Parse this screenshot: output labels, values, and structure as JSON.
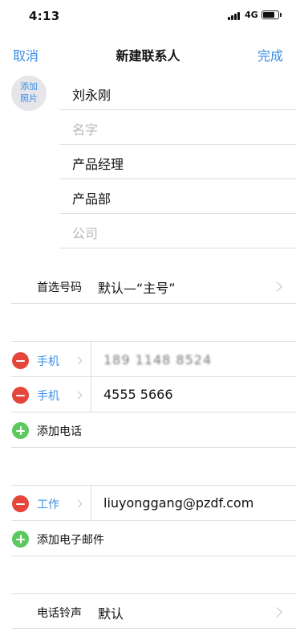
{
  "status_bar": {
    "time": "4:13",
    "network": "4G",
    "battery_level": 0.8
  },
  "nav": {
    "cancel_label": "取消",
    "title": "新建联系人",
    "done_label": "完成"
  },
  "photo": {
    "label_line1": "添加",
    "label_line2": "照片"
  },
  "name_fields": {
    "last_name": "刘永刚",
    "first_name_placeholder": "名字",
    "job_title": "产品经理",
    "department": "产品部",
    "company_placeholder": "公司"
  },
  "preferred_number": {
    "label": "首选号码",
    "value": "默认—“主号”"
  },
  "phones": [
    {
      "type": "手机",
      "number": "189 1148 8524"
    },
    {
      "type": "手机",
      "number": "4555 5666"
    }
  ],
  "add_phone_label": "添加电话",
  "emails": [
    {
      "type": "工作",
      "address": "liuyonggang@pzdf.com"
    }
  ],
  "add_email_label": "添加电子邮件",
  "ringtone": {
    "label": "电话铃声",
    "value": "默认"
  },
  "colors": {
    "accent": "#3a8ee6",
    "delete": "#e5453a",
    "add": "#5bc95e",
    "separator": "#dedede"
  }
}
